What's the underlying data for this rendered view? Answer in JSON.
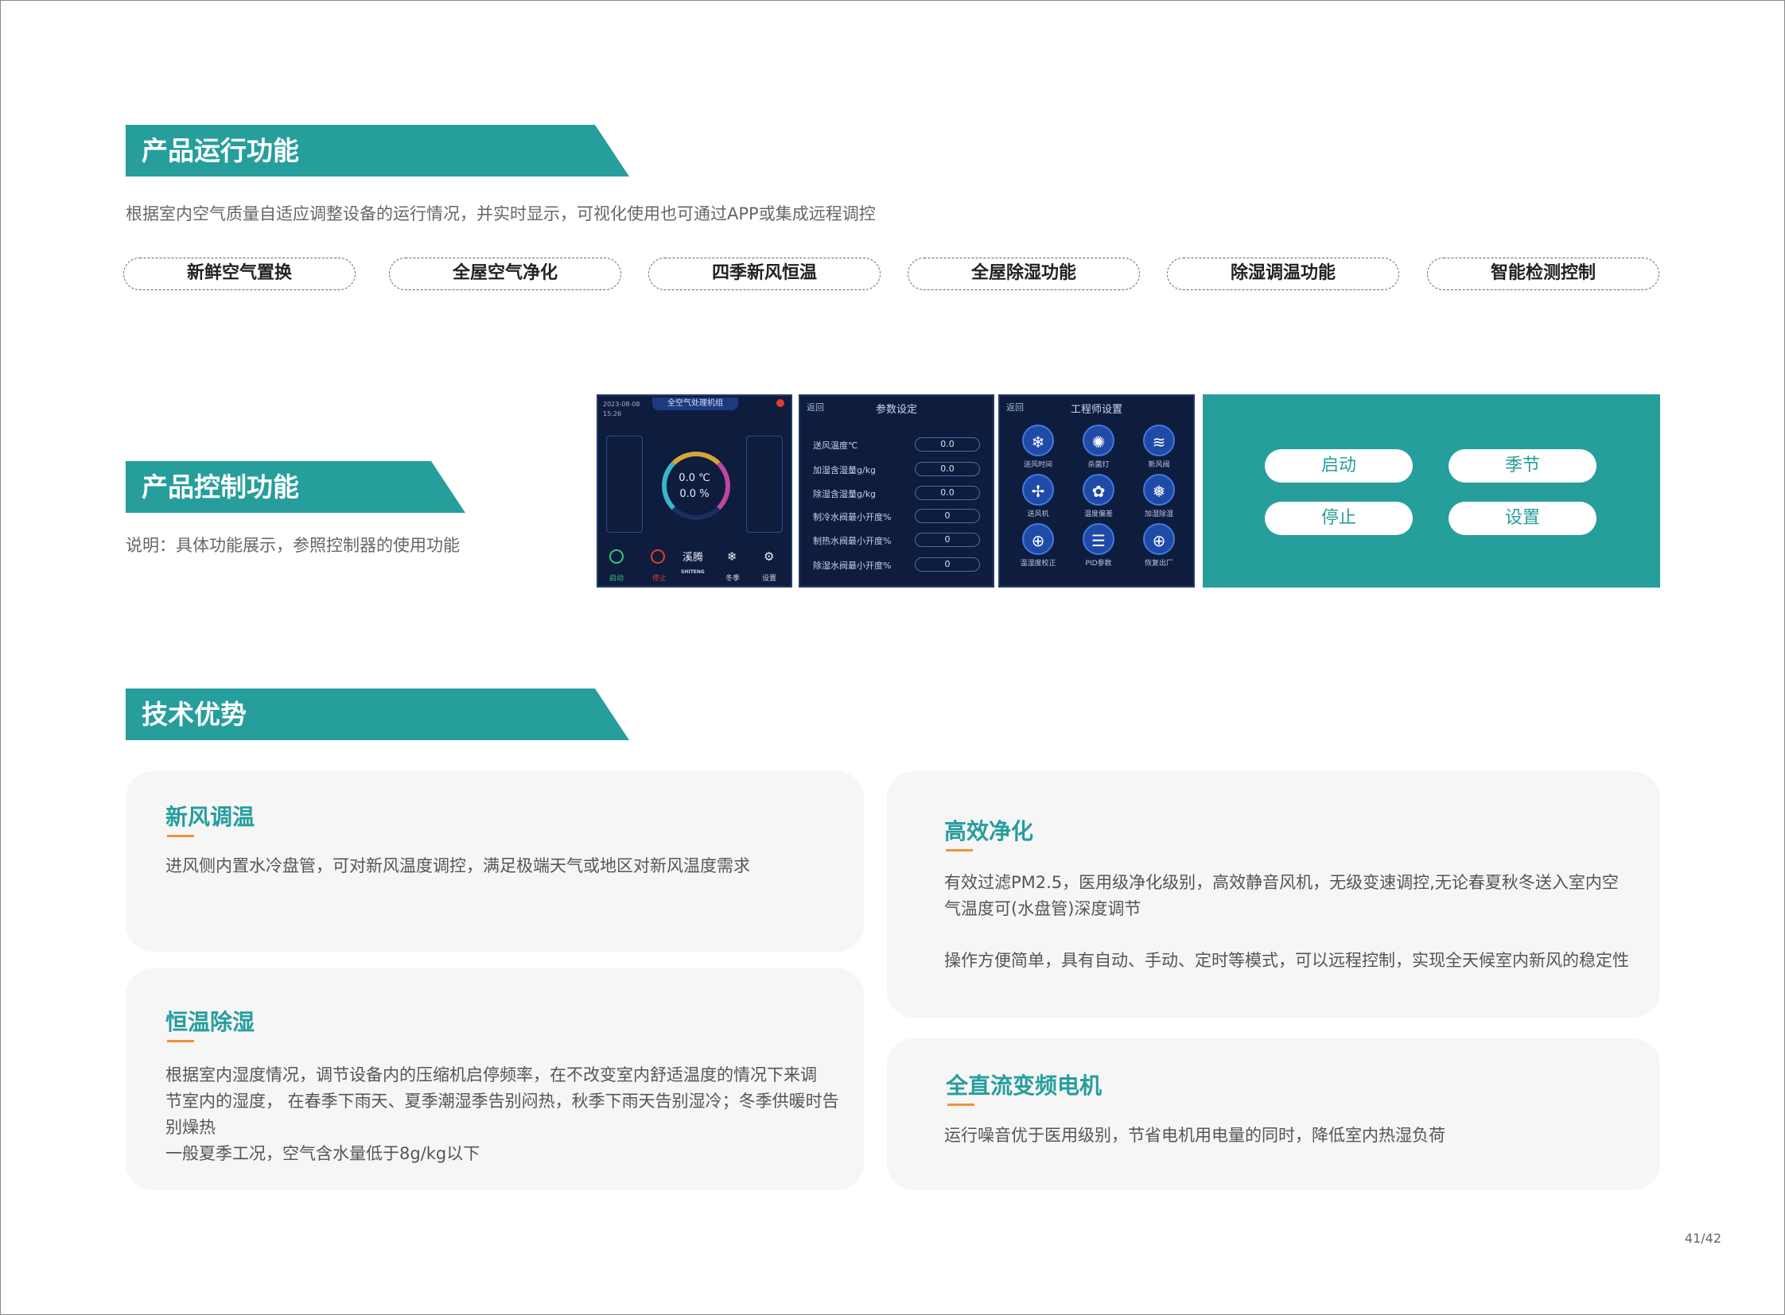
{
  "section1": {
    "title": "产品运行功能",
    "desc": "根据室内空气质量自适应调整设备的运行情况，并实时显示，可视化使用也可通过APP或集成远程调控",
    "features": [
      "新鲜空气置换",
      "全屋空气净化",
      "四季新风恒温",
      "全屋除湿功能",
      "除湿调温功能",
      "智能检测控制"
    ]
  },
  "section2": {
    "title": "产品控制功能",
    "desc": "说明：具体功能展示，参照控制器的使用功能",
    "screen1": {
      "title": "全空气处理机组",
      "datetime": "2023-08-08",
      "time": "15:26",
      "temp": "0.0 ℃",
      "hum": "0.0 %",
      "buttons": [
        "启动",
        "停止",
        "冬季",
        "设置"
      ],
      "brand": "溪腾",
      "brand_en": "SHITENG"
    },
    "screen2": {
      "back": "返回",
      "title": "参数设定",
      "rows": [
        {
          "label": "送风温度℃",
          "value": "0.0"
        },
        {
          "label": "加湿含湿量g/kg",
          "value": "0.0"
        },
        {
          "label": "除湿含湿量g/kg",
          "value": "0.0"
        },
        {
          "label": "制冷水阀最小开度%",
          "value": "0"
        },
        {
          "label": "制热水阀最小开度%",
          "value": "0"
        },
        {
          "label": "除湿水阀最小开度%",
          "value": "0"
        }
      ]
    },
    "screen3": {
      "back": "返回",
      "title": "工程师设置",
      "icons": [
        {
          "label": "送风时间",
          "glyph": "❄"
        },
        {
          "label": "杀菌灯",
          "glyph": "✺"
        },
        {
          "label": "新风阀",
          "glyph": "≋"
        },
        {
          "label": "送风机",
          "glyph": "✢"
        },
        {
          "label": "温度偏差",
          "glyph": "✿"
        },
        {
          "label": "加湿除湿",
          "glyph": "❅"
        },
        {
          "label": "温湿度校正",
          "glyph": "⊕"
        },
        {
          "label": "PID参数",
          "glyph": "☰"
        },
        {
          "label": "恢复出厂",
          "glyph": "⊕"
        }
      ]
    },
    "controls": {
      "start": "启动",
      "season": "季节",
      "stop": "停止",
      "settings": "设置"
    }
  },
  "section3": {
    "title": "技术优势",
    "cards": [
      {
        "title": "新风调温",
        "text": [
          "进风侧内置水冷盘管，可对新风温度调控，满足极端天气或地区对新风温度需求"
        ]
      },
      {
        "title": "恒温除湿",
        "text": [
          "根据室内湿度情况，调节设备内的压缩机启停频率，在不改变室内舒适温度的情况下来调",
          "节室内的湿度，  在春季下雨天、夏季潮湿季告别闷热，秋季下雨天告别湿冷；冬季供暖时告",
          "别燥热",
          "一般夏季工况，空气含水量低于8g/kg以下"
        ]
      },
      {
        "title": "高效净化",
        "text": [
          "有效过滤PM2.5，医用级净化级别，高效静音风机，无级变速调控,无论春夏秋冬送入室内空",
          "气温度可(水盘管)深度调节",
          "",
          "操作方便简单，具有自动、手动、定时等模式，可以远程控制，实现全天候室内新风的稳定性"
        ]
      },
      {
        "title": "全直流变频电机",
        "text": [
          "运行噪音优于医用级别，节省电机用电量的同时，降低室内热湿负荷"
        ]
      }
    ]
  },
  "page": "41/42",
  "colors": {
    "accent": "#269e9c",
    "underline": "#f0923a",
    "screen_bg": "#0e1c3d"
  }
}
